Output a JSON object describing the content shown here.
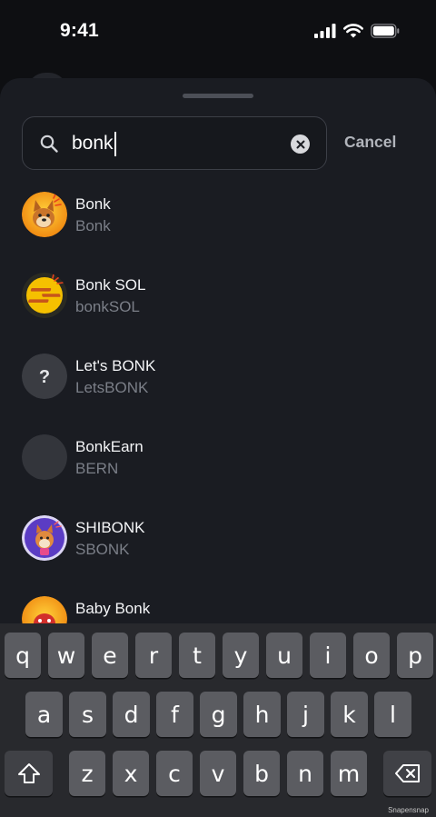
{
  "status_bar": {
    "time": "9:41"
  },
  "search": {
    "query": "bonk"
  },
  "cancel_label": "Cancel",
  "tokens": [
    {
      "name": "Bonk",
      "symbol": "Bonk",
      "icon": "bonk-dog-logo"
    },
    {
      "name": "Bonk SOL",
      "symbol": "bonkSOL",
      "icon": "bonksol-logo"
    },
    {
      "name": "Let's BONK",
      "symbol": "LetsBONK",
      "icon": "question-mark-logo"
    },
    {
      "name": "BonkEarn",
      "symbol": "BERN",
      "icon": "blank-logo"
    },
    {
      "name": "SHIBONK",
      "symbol": "SBONK",
      "icon": "shibonk-logo"
    },
    {
      "name": "Baby Bonk",
      "symbol": "",
      "icon": "baby-bonk-logo"
    }
  ],
  "keyboard": {
    "row1": [
      "q",
      "w",
      "e",
      "r",
      "t",
      "y",
      "u",
      "i",
      "o",
      "p"
    ],
    "row2": [
      "a",
      "s",
      "d",
      "f",
      "g",
      "h",
      "j",
      "k",
      "l"
    ],
    "row3": [
      "z",
      "x",
      "c",
      "v",
      "b",
      "n",
      "m"
    ]
  },
  "watermark": "Snapensnap",
  "colors": {
    "sheet": "#1a1c22",
    "background": "#0e0f12",
    "muted": "#7b7f88",
    "key": "#5b5c61"
  }
}
